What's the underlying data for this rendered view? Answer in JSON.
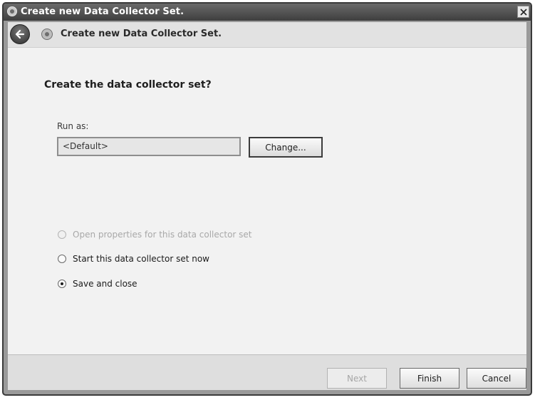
{
  "window": {
    "title": "Create new Data Collector Set."
  },
  "header": {
    "title": "Create new Data Collector Set."
  },
  "main": {
    "question": "Create the data collector set?",
    "run_as": {
      "label": "Run as:",
      "value": "<Default>",
      "change_label": "Change..."
    },
    "options": [
      {
        "label": "Open properties for this data collector set",
        "checked": false,
        "disabled": true
      },
      {
        "label": "Start this data collector set now",
        "checked": false,
        "disabled": false
      },
      {
        "label": "Save and close",
        "checked": true,
        "disabled": false
      }
    ]
  },
  "footer": {
    "next_label": "Next",
    "finish_label": "Finish",
    "cancel_label": "Cancel"
  },
  "icons": {
    "title": "data-collector-icon",
    "back": "back-arrow-icon",
    "header": "data-collector-icon",
    "close": "close-icon"
  }
}
